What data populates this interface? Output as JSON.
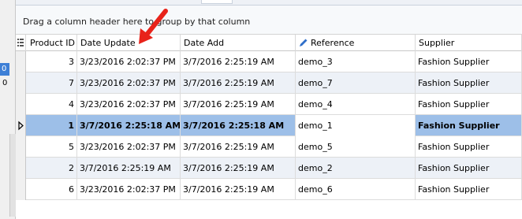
{
  "left_panel": {
    "selected_value": "0",
    "value": "0"
  },
  "group_panel": {
    "text": "Drag a column header here to group by that column"
  },
  "columns": [
    {
      "label": "Product ID"
    },
    {
      "label": "Date Update"
    },
    {
      "label": "Date Add"
    },
    {
      "label": "Reference",
      "icon": "pencil-icon"
    },
    {
      "label": "Supplier"
    }
  ],
  "rows": [
    {
      "id": "3",
      "date_update": "3/23/2016 2:02:37 PM",
      "date_add": "3/7/2016 2:25:19 AM",
      "reference": "demo_3",
      "supplier": "Fashion Supplier"
    },
    {
      "id": "7",
      "date_update": "3/23/2016 2:02:37 PM",
      "date_add": "3/7/2016 2:25:19 AM",
      "reference": "demo_7",
      "supplier": "Fashion Supplier"
    },
    {
      "id": "4",
      "date_update": "3/23/2016 2:02:37 PM",
      "date_add": "3/7/2016 2:25:19 AM",
      "reference": "demo_4",
      "supplier": "Fashion Supplier"
    },
    {
      "id": "1",
      "date_update": "3/7/2016 2:25:18 AM",
      "date_add": "3/7/2016 2:25:18 AM",
      "reference": "demo_1",
      "supplier": "Fashion Supplier",
      "selected": true
    },
    {
      "id": "5",
      "date_update": "3/23/2016 2:02:37 PM",
      "date_add": "3/7/2016 2:25:19 AM",
      "reference": "demo_5",
      "supplier": "Fashion Supplier"
    },
    {
      "id": "2",
      "date_update": "3/7/2016 2:25:19 AM",
      "date_add": "3/7/2016 2:25:19 AM",
      "reference": "demo_2",
      "supplier": "Fashion Supplier"
    },
    {
      "id": "6",
      "date_update": "3/23/2016 2:02:37 PM",
      "date_add": "3/7/2016 2:25:19 AM",
      "reference": "demo_6",
      "supplier": "Fashion Supplier"
    }
  ],
  "colors": {
    "selected_row": "#9dbfe8",
    "alt_row": "#edf1f7",
    "arrow": "#e8231a"
  }
}
